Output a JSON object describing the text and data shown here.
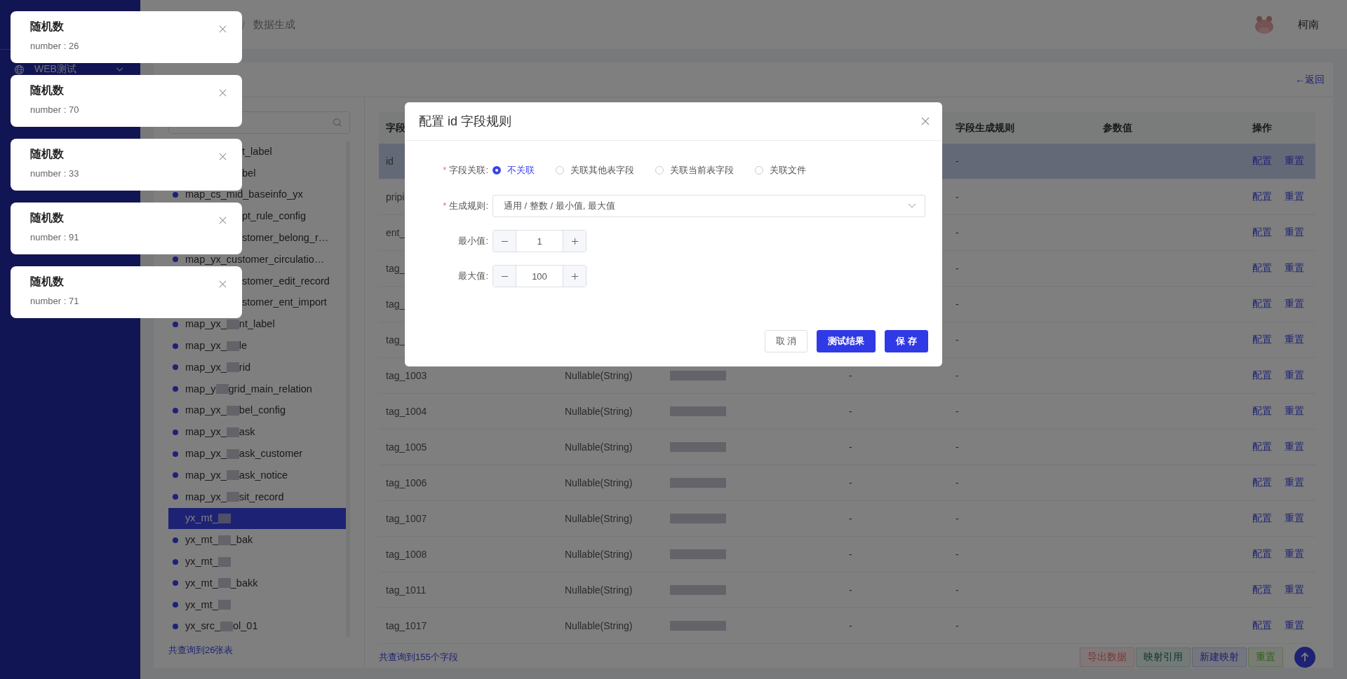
{
  "sidebar": {
    "menu_items": [
      {
        "label": "WEB测试"
      }
    ]
  },
  "header": {
    "breadcrumb": [
      {
        "separator": "/",
        "label": "数据生成"
      }
    ],
    "user": "柯南"
  },
  "card": {
    "back_link": "←返回"
  },
  "tables_panel": {
    "items": [
      {
        "segments": [
          "t_label"
        ],
        "covered": true,
        "trailing_blur": false,
        "selected": false
      },
      {
        "segments": [
          "bel"
        ],
        "covered": true,
        "trailing_blur": false,
        "selected": false
      },
      {
        "segments": [
          "map_cs_mid_baseinfo_yx"
        ],
        "covered": false,
        "trailing_blur": false,
        "selected": false
      },
      {
        "segments": [
          "pt_rule_config"
        ],
        "covered": true,
        "trailing_blur": false,
        "selected": false
      },
      {
        "segments": [
          "stomer_belong_r…"
        ],
        "covered": true,
        "trailing_blur": false,
        "selected": false
      },
      {
        "segments": [
          "map_yx_customer_circulatio…"
        ],
        "covered": false,
        "trailing_blur": false,
        "selected": false
      },
      {
        "segments": [
          "stomer_edit_record"
        ],
        "covered": true,
        "trailing_blur": false,
        "selected": false
      },
      {
        "segments": [
          "stomer_ent_import"
        ],
        "covered": true,
        "trailing_blur": false,
        "selected": false
      },
      {
        "segments": [
          "map_yx_",
          "nt_label"
        ],
        "covered": false,
        "trailing_blur": false,
        "selected": false
      },
      {
        "segments": [
          "map_yx_",
          "le"
        ],
        "covered": false,
        "trailing_blur": false,
        "selected": false
      },
      {
        "segments": [
          "map_yx_",
          "rid"
        ],
        "covered": false,
        "trailing_blur": false,
        "selected": false
      },
      {
        "segments": [
          "map_y",
          "grid_main_relation"
        ],
        "covered": false,
        "trailing_blur": false,
        "selected": false
      },
      {
        "segments": [
          "map_yx_",
          "bel_config"
        ],
        "covered": false,
        "trailing_blur": false,
        "selected": false
      },
      {
        "segments": [
          "map_yx_",
          "ask"
        ],
        "covered": false,
        "trailing_blur": false,
        "selected": false
      },
      {
        "segments": [
          "map_yx_",
          "ask_customer"
        ],
        "covered": false,
        "trailing_blur": false,
        "selected": false
      },
      {
        "segments": [
          "map_yx_",
          "ask_notice"
        ],
        "covered": false,
        "trailing_blur": false,
        "selected": false
      },
      {
        "segments": [
          "map_yx_",
          "sit_record"
        ],
        "covered": false,
        "trailing_blur": false,
        "selected": false
      },
      {
        "segments": [
          "yx_mt_"
        ],
        "covered": false,
        "trailing_blur": true,
        "selected": true
      },
      {
        "segments": [
          "yx_mt_",
          "_bak"
        ],
        "covered": false,
        "trailing_blur": false,
        "selected": false
      },
      {
        "segments": [
          "yx_mt_"
        ],
        "covered": false,
        "trailing_blur": true,
        "selected": false
      },
      {
        "segments": [
          "yx_mt_",
          "_bakk"
        ],
        "covered": false,
        "trailing_blur": false,
        "selected": false
      },
      {
        "segments": [
          "yx_mt_"
        ],
        "covered": false,
        "trailing_blur": true,
        "selected": false
      },
      {
        "segments": [
          "yx_src_",
          "ol_01"
        ],
        "covered": false,
        "trailing_blur": false,
        "selected": false
      }
    ],
    "footer": "共查询到26张表"
  },
  "fields_panel": {
    "header": {
      "column_1": "字段",
      "column_5": "字段生成规则",
      "column_6": "参数值",
      "column_7": "操作"
    },
    "rows": [
      {
        "name": "id",
        "rule": "-",
        "actions": [
          "配置",
          "重置"
        ],
        "selected": true
      },
      {
        "name": "pripi",
        "rule": "-",
        "actions": [
          "配置",
          "重置"
        ],
        "selected": false
      },
      {
        "name": "ent_",
        "rule": "-",
        "actions": [
          "配置",
          "重置"
        ],
        "selected": false
      },
      {
        "name": "tag_",
        "rule": "-",
        "actions": [
          "配置",
          "重置"
        ],
        "selected": false
      },
      {
        "name": "tag_",
        "rule": "-",
        "actions": [
          "配置",
          "重置"
        ],
        "selected": false
      },
      {
        "name": "tag_",
        "rule": "-",
        "actions": [
          "配置",
          "重置"
        ],
        "selected": false
      },
      {
        "name": "tag_1003",
        "type": "Nullable(String)",
        "blurred_description": true,
        "column_4": "-",
        "rule": "-",
        "actions": [
          "配置",
          "重置"
        ],
        "selected": false
      },
      {
        "name": "tag_1004",
        "type": "Nullable(String)",
        "blurred_description": true,
        "column_4": "-",
        "rule": "-",
        "actions": [
          "配置",
          "重置"
        ],
        "selected": false
      },
      {
        "name": "tag_1005",
        "type": "Nullable(String)",
        "blurred_description": true,
        "column_4": "-",
        "rule": "-",
        "actions": [
          "配置",
          "重置"
        ],
        "selected": false
      },
      {
        "name": "tag_1006",
        "type": "Nullable(String)",
        "blurred_description": true,
        "column_4": "-",
        "rule": "-",
        "actions": [
          "配置",
          "重置"
        ],
        "selected": false
      },
      {
        "name": "tag_1007",
        "type": "Nullable(String)",
        "blurred_description": true,
        "column_4": "-",
        "rule": "-",
        "actions": [
          "配置",
          "重置"
        ],
        "selected": false
      },
      {
        "name": "tag_1008",
        "type": "Nullable(String)",
        "blurred_description": true,
        "column_4": "-",
        "rule": "-",
        "actions": [
          "配置",
          "重置"
        ],
        "selected": false
      },
      {
        "name": "tag_1011",
        "type": "Nullable(String)",
        "blurred_description": true,
        "column_4": "-",
        "rule": "-",
        "actions": [
          "配置",
          "重置"
        ],
        "selected": false
      },
      {
        "name": "tag_1017",
        "type": "Nullable(String)",
        "blurred_description": true,
        "column_4": "-",
        "rule": "-",
        "actions": [
          "配置",
          "重置"
        ],
        "selected": false
      }
    ],
    "footer": "共查询到155个字段",
    "buttons": [
      {
        "label": "导出数据",
        "kind": "danger"
      },
      {
        "label": "映射引用",
        "kind": "teal"
      },
      {
        "label": "新建映射",
        "kind": "primary"
      },
      {
        "label": "重置",
        "kind": "success"
      }
    ]
  },
  "modal": {
    "title": "配置 id 字段规则",
    "relation": {
      "label": "字段关联:",
      "required_mark": "*",
      "options": [
        {
          "label": "不关联",
          "selected": true
        },
        {
          "label": "关联其他表字段",
          "selected": false
        },
        {
          "label": "关联当前表字段",
          "selected": false
        },
        {
          "label": "关联文件",
          "selected": false
        }
      ]
    },
    "rule": {
      "label": "生成规则:",
      "required_mark": "*",
      "value": "通用 / 整数 / 最小值, 最大值"
    },
    "numbers": [
      {
        "label": "最小值:",
        "value": "1"
      },
      {
        "label": "最大值:",
        "value": "100"
      }
    ],
    "buttons": [
      {
        "label": "取 消",
        "kind": "default"
      },
      {
        "label": "测试结果",
        "kind": "primary"
      },
      {
        "label": "保 存",
        "kind": "primary"
      }
    ]
  },
  "notifications": [
    {
      "title": "随机数",
      "text": "number : 26"
    },
    {
      "title": "随机数",
      "text": "number : 70"
    },
    {
      "title": "随机数",
      "text": "number : 33"
    },
    {
      "title": "随机数",
      "text": "number : 91"
    },
    {
      "title": "随机数",
      "text": "number : 71"
    }
  ]
}
